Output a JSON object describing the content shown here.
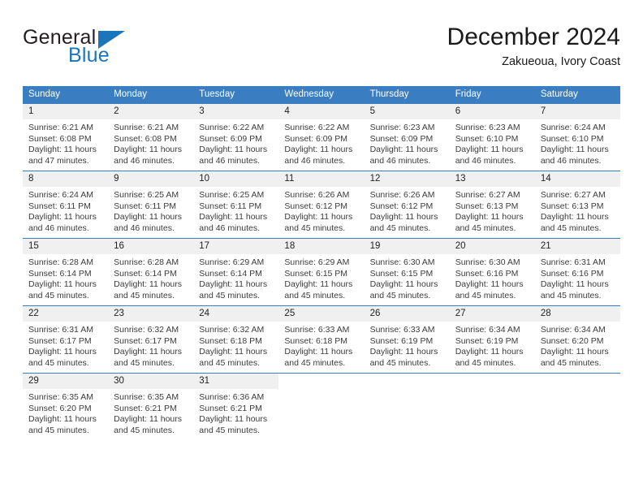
{
  "brand": {
    "name_part1": "General",
    "name_part2": "Blue",
    "triangle_color": "#1b75bb"
  },
  "header": {
    "month_title": "December 2024",
    "location": "Zakueoua, Ivory Coast"
  },
  "theme": {
    "header_blue": "#3a7dc0",
    "daynum_bg": "#f0f0f0",
    "text": "#3b3b3b"
  },
  "weekdays": [
    "Sunday",
    "Monday",
    "Tuesday",
    "Wednesday",
    "Thursday",
    "Friday",
    "Saturday"
  ],
  "weeks": [
    [
      {
        "day": "1",
        "sunrise": "Sunrise: 6:21 AM",
        "sunset": "Sunset: 6:08 PM",
        "daylight1": "Daylight: 11 hours",
        "daylight2": "and 47 minutes."
      },
      {
        "day": "2",
        "sunrise": "Sunrise: 6:21 AM",
        "sunset": "Sunset: 6:08 PM",
        "daylight1": "Daylight: 11 hours",
        "daylight2": "and 46 minutes."
      },
      {
        "day": "3",
        "sunrise": "Sunrise: 6:22 AM",
        "sunset": "Sunset: 6:09 PM",
        "daylight1": "Daylight: 11 hours",
        "daylight2": "and 46 minutes."
      },
      {
        "day": "4",
        "sunrise": "Sunrise: 6:22 AM",
        "sunset": "Sunset: 6:09 PM",
        "daylight1": "Daylight: 11 hours",
        "daylight2": "and 46 minutes."
      },
      {
        "day": "5",
        "sunrise": "Sunrise: 6:23 AM",
        "sunset": "Sunset: 6:09 PM",
        "daylight1": "Daylight: 11 hours",
        "daylight2": "and 46 minutes."
      },
      {
        "day": "6",
        "sunrise": "Sunrise: 6:23 AM",
        "sunset": "Sunset: 6:10 PM",
        "daylight1": "Daylight: 11 hours",
        "daylight2": "and 46 minutes."
      },
      {
        "day": "7",
        "sunrise": "Sunrise: 6:24 AM",
        "sunset": "Sunset: 6:10 PM",
        "daylight1": "Daylight: 11 hours",
        "daylight2": "and 46 minutes."
      }
    ],
    [
      {
        "day": "8",
        "sunrise": "Sunrise: 6:24 AM",
        "sunset": "Sunset: 6:11 PM",
        "daylight1": "Daylight: 11 hours",
        "daylight2": "and 46 minutes."
      },
      {
        "day": "9",
        "sunrise": "Sunrise: 6:25 AM",
        "sunset": "Sunset: 6:11 PM",
        "daylight1": "Daylight: 11 hours",
        "daylight2": "and 46 minutes."
      },
      {
        "day": "10",
        "sunrise": "Sunrise: 6:25 AM",
        "sunset": "Sunset: 6:11 PM",
        "daylight1": "Daylight: 11 hours",
        "daylight2": "and 46 minutes."
      },
      {
        "day": "11",
        "sunrise": "Sunrise: 6:26 AM",
        "sunset": "Sunset: 6:12 PM",
        "daylight1": "Daylight: 11 hours",
        "daylight2": "and 45 minutes."
      },
      {
        "day": "12",
        "sunrise": "Sunrise: 6:26 AM",
        "sunset": "Sunset: 6:12 PM",
        "daylight1": "Daylight: 11 hours",
        "daylight2": "and 45 minutes."
      },
      {
        "day": "13",
        "sunrise": "Sunrise: 6:27 AM",
        "sunset": "Sunset: 6:13 PM",
        "daylight1": "Daylight: 11 hours",
        "daylight2": "and 45 minutes."
      },
      {
        "day": "14",
        "sunrise": "Sunrise: 6:27 AM",
        "sunset": "Sunset: 6:13 PM",
        "daylight1": "Daylight: 11 hours",
        "daylight2": "and 45 minutes."
      }
    ],
    [
      {
        "day": "15",
        "sunrise": "Sunrise: 6:28 AM",
        "sunset": "Sunset: 6:14 PM",
        "daylight1": "Daylight: 11 hours",
        "daylight2": "and 45 minutes."
      },
      {
        "day": "16",
        "sunrise": "Sunrise: 6:28 AM",
        "sunset": "Sunset: 6:14 PM",
        "daylight1": "Daylight: 11 hours",
        "daylight2": "and 45 minutes."
      },
      {
        "day": "17",
        "sunrise": "Sunrise: 6:29 AM",
        "sunset": "Sunset: 6:14 PM",
        "daylight1": "Daylight: 11 hours",
        "daylight2": "and 45 minutes."
      },
      {
        "day": "18",
        "sunrise": "Sunrise: 6:29 AM",
        "sunset": "Sunset: 6:15 PM",
        "daylight1": "Daylight: 11 hours",
        "daylight2": "and 45 minutes."
      },
      {
        "day": "19",
        "sunrise": "Sunrise: 6:30 AM",
        "sunset": "Sunset: 6:15 PM",
        "daylight1": "Daylight: 11 hours",
        "daylight2": "and 45 minutes."
      },
      {
        "day": "20",
        "sunrise": "Sunrise: 6:30 AM",
        "sunset": "Sunset: 6:16 PM",
        "daylight1": "Daylight: 11 hours",
        "daylight2": "and 45 minutes."
      },
      {
        "day": "21",
        "sunrise": "Sunrise: 6:31 AM",
        "sunset": "Sunset: 6:16 PM",
        "daylight1": "Daylight: 11 hours",
        "daylight2": "and 45 minutes."
      }
    ],
    [
      {
        "day": "22",
        "sunrise": "Sunrise: 6:31 AM",
        "sunset": "Sunset: 6:17 PM",
        "daylight1": "Daylight: 11 hours",
        "daylight2": "and 45 minutes."
      },
      {
        "day": "23",
        "sunrise": "Sunrise: 6:32 AM",
        "sunset": "Sunset: 6:17 PM",
        "daylight1": "Daylight: 11 hours",
        "daylight2": "and 45 minutes."
      },
      {
        "day": "24",
        "sunrise": "Sunrise: 6:32 AM",
        "sunset": "Sunset: 6:18 PM",
        "daylight1": "Daylight: 11 hours",
        "daylight2": "and 45 minutes."
      },
      {
        "day": "25",
        "sunrise": "Sunrise: 6:33 AM",
        "sunset": "Sunset: 6:18 PM",
        "daylight1": "Daylight: 11 hours",
        "daylight2": "and 45 minutes."
      },
      {
        "day": "26",
        "sunrise": "Sunrise: 6:33 AM",
        "sunset": "Sunset: 6:19 PM",
        "daylight1": "Daylight: 11 hours",
        "daylight2": "and 45 minutes."
      },
      {
        "day": "27",
        "sunrise": "Sunrise: 6:34 AM",
        "sunset": "Sunset: 6:19 PM",
        "daylight1": "Daylight: 11 hours",
        "daylight2": "and 45 minutes."
      },
      {
        "day": "28",
        "sunrise": "Sunrise: 6:34 AM",
        "sunset": "Sunset: 6:20 PM",
        "daylight1": "Daylight: 11 hours",
        "daylight2": "and 45 minutes."
      }
    ],
    [
      {
        "day": "29",
        "sunrise": "Sunrise: 6:35 AM",
        "sunset": "Sunset: 6:20 PM",
        "daylight1": "Daylight: 11 hours",
        "daylight2": "and 45 minutes."
      },
      {
        "day": "30",
        "sunrise": "Sunrise: 6:35 AM",
        "sunset": "Sunset: 6:21 PM",
        "daylight1": "Daylight: 11 hours",
        "daylight2": "and 45 minutes."
      },
      {
        "day": "31",
        "sunrise": "Sunrise: 6:36 AM",
        "sunset": "Sunset: 6:21 PM",
        "daylight1": "Daylight: 11 hours",
        "daylight2": "and 45 minutes."
      },
      {
        "day": "",
        "sunrise": "",
        "sunset": "",
        "daylight1": "",
        "daylight2": ""
      },
      {
        "day": "",
        "sunrise": "",
        "sunset": "",
        "daylight1": "",
        "daylight2": ""
      },
      {
        "day": "",
        "sunrise": "",
        "sunset": "",
        "daylight1": "",
        "daylight2": ""
      },
      {
        "day": "",
        "sunrise": "",
        "sunset": "",
        "daylight1": "",
        "daylight2": ""
      }
    ]
  ]
}
